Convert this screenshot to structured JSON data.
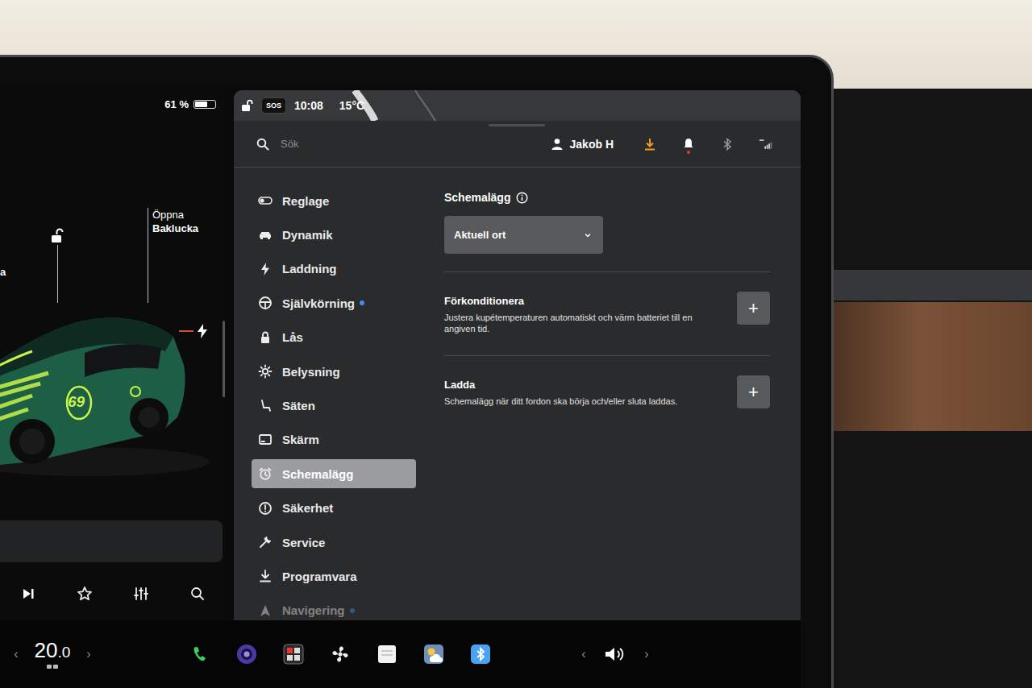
{
  "status": {
    "battery_text": "61 %",
    "battery_level": 0.61,
    "sos": "SOS",
    "time": "10:08",
    "temperature": "15°C"
  },
  "car": {
    "edge_label": "a",
    "trunk_action": "Öppna",
    "trunk_target": "Baklucka",
    "locked": false,
    "decal": "69"
  },
  "search": {
    "placeholder": "Sök"
  },
  "profile": {
    "name": "Jakob H"
  },
  "sidebar": {
    "items": [
      {
        "label": "Reglage",
        "selected": false,
        "badge": false,
        "dimmed": false
      },
      {
        "label": "Dynamik",
        "selected": false,
        "badge": false,
        "dimmed": false
      },
      {
        "label": "Laddning",
        "selected": false,
        "badge": false,
        "dimmed": false
      },
      {
        "label": "Självkörning",
        "selected": false,
        "badge": true,
        "dimmed": false
      },
      {
        "label": "Lås",
        "selected": false,
        "badge": false,
        "dimmed": false
      },
      {
        "label": "Belysning",
        "selected": false,
        "badge": false,
        "dimmed": false
      },
      {
        "label": "Säten",
        "selected": false,
        "badge": false,
        "dimmed": false
      },
      {
        "label": "Skärm",
        "selected": false,
        "badge": false,
        "dimmed": false
      },
      {
        "label": "Schemalägg",
        "selected": true,
        "badge": false,
        "dimmed": false
      },
      {
        "label": "Säkerhet",
        "selected": false,
        "badge": false,
        "dimmed": false
      },
      {
        "label": "Service",
        "selected": false,
        "badge": false,
        "dimmed": false
      },
      {
        "label": "Programvara",
        "selected": false,
        "badge": false,
        "dimmed": false
      },
      {
        "label": "Navigering",
        "selected": false,
        "badge": true,
        "dimmed": true
      }
    ]
  },
  "schedule": {
    "title": "Schemalägg",
    "location": "Aktuell ort",
    "sections": [
      {
        "title": "Förkonditionera",
        "description": "Justera kupétemperaturen automatiskt och värm batteriet till en angiven tid.",
        "action": "+"
      },
      {
        "title": "Ladda",
        "description": "Schemalägg när ditt fordon ska börja och/eller sluta laddas.",
        "action": "+"
      }
    ]
  },
  "climate": {
    "prev": "‹",
    "temperature": "20",
    "decimal": ".0",
    "next": "›"
  },
  "volume": {
    "prev": "‹",
    "next": "›"
  }
}
